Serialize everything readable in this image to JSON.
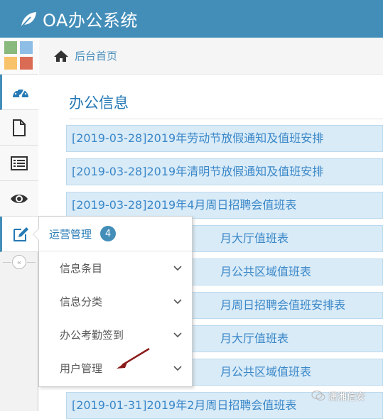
{
  "app": {
    "title": "OA办公系统"
  },
  "breadcrumb": {
    "label": "后台首页"
  },
  "colors": {
    "topbar": "#438eb9",
    "accent": "#2679b5",
    "tile_green": "#89b97c",
    "tile_blue": "#8ebee6",
    "tile_orange": "#f8c26a",
    "tile_red": "#da6c56"
  },
  "sidebar": {
    "items": [
      {
        "icon": "dashboard-icon"
      },
      {
        "icon": "file-icon"
      },
      {
        "icon": "list-icon"
      },
      {
        "icon": "eye-icon"
      },
      {
        "icon": "edit-icon"
      }
    ],
    "collapse_icon": "double-chevron-left-icon"
  },
  "main": {
    "title": "办公信息",
    "news": [
      "[2019-03-28]2019年劳动节放假通知及值班安排",
      "[2019-03-28]2019年清明节放假通知及值班安排",
      "[2019-03-28]2019年4月周日招聘会值班表",
      "月大厅值班表",
      "月公共区域值班表",
      "月周日招聘会值班安排表",
      "月大厅值班表",
      "月公共区域值班表",
      "[2019-01-31]2019年2月周日招聘会值班表"
    ]
  },
  "flyout": {
    "title": "运营管理",
    "badge": "4",
    "items": [
      {
        "label": "信息条目"
      },
      {
        "label": "信息分类"
      },
      {
        "label": "办公考勤签到"
      },
      {
        "label": "用户管理"
      }
    ]
  },
  "watermark": {
    "text": "潇湘信安"
  }
}
